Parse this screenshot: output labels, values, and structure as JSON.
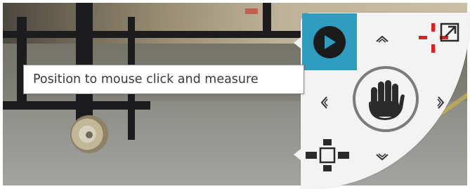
{
  "tooltip": {
    "text": "Position to mouse click and measure"
  },
  "controls": {
    "play_icon": "play-icon",
    "pan_up_icon": "chevron-up-icon",
    "pan_down_icon": "chevron-down-icon",
    "pan_left_icon": "chevron-left-icon",
    "pan_right_icon": "chevron-right-icon",
    "hand_icon": "hand-icon",
    "crosshair_icon": "crosshair-icon",
    "expand_icon": "expand-icon",
    "center_icon": "center-position-icon"
  },
  "colors": {
    "accent": "#2e9dc0",
    "crosshair": "#e02020",
    "panel": "#f3f3f3"
  }
}
